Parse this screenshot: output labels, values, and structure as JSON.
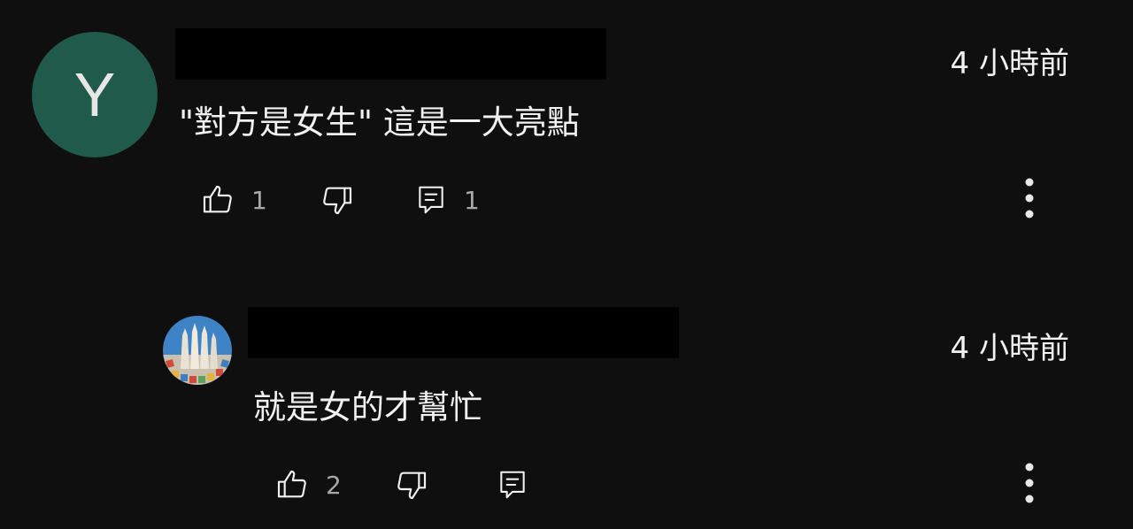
{
  "comments": [
    {
      "avatar_letter": "Y",
      "avatar_color": "#1f5a4b",
      "time": "4 小時前",
      "text": "\"對方是女生\" 這是一大亮點",
      "like_count": "1",
      "reply_count": "1",
      "icons": [
        "thumb-up-icon",
        "thumb-down-icon",
        "reply-icon",
        "more-vert-icon"
      ]
    },
    {
      "avatar_image": "cathedral-spires",
      "time": "4 小時前",
      "text": "就是女的才幫忙",
      "like_count": "2",
      "icons": [
        "thumb-up-icon",
        "thumb-down-icon",
        "reply-icon",
        "more-vert-icon"
      ]
    }
  ],
  "theme": {
    "background": "#0f0f0f",
    "text": "#f1f1f1",
    "muted": "#a8a8a8",
    "redaction": "#000000"
  }
}
